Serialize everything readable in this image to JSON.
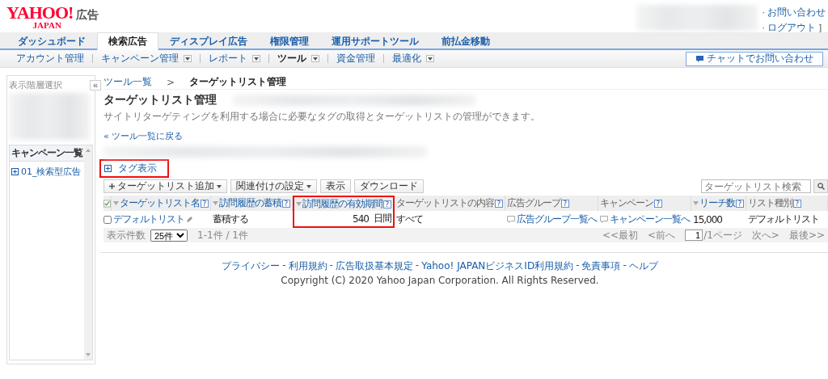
{
  "header": {
    "logo": "YAHOO!",
    "logo_sub": "JAPAN",
    "logo_suffix": "広告",
    "links": [
      "お問い合わせ",
      "ログアウト"
    ],
    "bullet": "·",
    "bracket": "]"
  },
  "tabs": [
    {
      "label": "ダッシュボード",
      "selected": false
    },
    {
      "label": "検索広告",
      "selected": true
    },
    {
      "label": "ディスプレイ広告",
      "selected": false
    },
    {
      "label": "権限管理",
      "selected": false
    },
    {
      "label": "運用サポートツール",
      "selected": false
    },
    {
      "label": "前払金移動",
      "selected": false
    }
  ],
  "subnav": [
    {
      "label": "アカウント管理",
      "dropdown": false,
      "selected": false
    },
    {
      "label": "キャンペーン管理",
      "dropdown": true,
      "selected": false
    },
    {
      "label": "レポート",
      "dropdown": true,
      "selected": false
    },
    {
      "label": "ツール",
      "dropdown": true,
      "selected": true
    },
    {
      "label": "資金管理",
      "dropdown": false,
      "selected": false
    },
    {
      "label": "最適化",
      "dropdown": true,
      "selected": false
    }
  ],
  "chat_button": "チャットでお問い合わせ",
  "sidebar": {
    "title": "表示階層選択",
    "collapse": "«",
    "list_title": "キャンペーン一覧",
    "items": [
      {
        "label": "01_検索型広告"
      }
    ]
  },
  "breadcrumb": {
    "items": [
      "ツール一覧",
      "ターゲットリスト管理"
    ],
    "separator": ">"
  },
  "page_title": "ターゲットリスト管理",
  "description": "サイトリターゲティングを利用する場合に必要なタグの取得とターゲットリストの管理ができます。",
  "back_link": "« ツール一覧に戻る",
  "tag_toggle": {
    "label": "タグ表示",
    "highlighted": true
  },
  "toolbar": [
    {
      "label": "ターゲットリスト追加",
      "plus": true,
      "dropdown": true
    },
    {
      "label": "関連付けの設定",
      "plus": false,
      "dropdown": true
    },
    {
      "label": "表示",
      "plus": false,
      "dropdown": false
    },
    {
      "label": "ダウンロード",
      "plus": false,
      "dropdown": false
    }
  ],
  "search": {
    "placeholder": "ターゲットリスト検索"
  },
  "table": {
    "select_all_checked": true,
    "help": "?",
    "columns": [
      {
        "label": "ターゲットリスト名",
        "sortable": true,
        "highlighted": false
      },
      {
        "label": "訪問履歴の蓄積",
        "sortable": true,
        "highlighted": false
      },
      {
        "label": "訪問履歴の有効期間",
        "sortable": true,
        "highlighted": true
      },
      {
        "label": "ターゲットリストの内容",
        "sortable": false,
        "highlighted": false
      },
      {
        "label": "広告グループ",
        "sortable": false,
        "highlighted": false
      },
      {
        "label": "キャンペーン",
        "sortable": false,
        "highlighted": false
      },
      {
        "label": "リーチ数",
        "sortable": true,
        "highlighted": false
      },
      {
        "label": "リスト種別",
        "sortable": false,
        "highlighted": false
      }
    ],
    "rows": [
      {
        "checked": false,
        "cells": [
          {
            "kind": "edit-link",
            "text": "デフォルトリスト"
          },
          {
            "kind": "text",
            "text": "蓄積する"
          },
          {
            "kind": "days",
            "text": "540",
            "unit": "日間"
          },
          {
            "kind": "text",
            "text": "すべて"
          },
          {
            "kind": "comment-link",
            "text": "広告グループ一覧へ"
          },
          {
            "kind": "comment-link",
            "text": "キャンペーン一覧へ"
          },
          {
            "kind": "text",
            "text": "15,000"
          },
          {
            "kind": "text",
            "text": "デフォルトリスト"
          }
        ]
      }
    ]
  },
  "pager": {
    "per_page_label": "表示件数",
    "per_page": "25件",
    "range": "1-1件 / 1件",
    "first": "<<最初",
    "prev": "<前へ",
    "page": "1",
    "of_pages": "/1ページ",
    "next": "次へ>",
    "last": "最後>>"
  },
  "footer": {
    "links": [
      "プライバシー",
      "利用規約",
      "広告取扱基本規定",
      "Yahoo! JAPANビジネスID利用規約",
      "免責事項",
      "ヘルプ"
    ],
    "separator": "-",
    "copyright": "Copyright (C) 2020 Yahoo Japan Corporation. All Rights Reserved."
  }
}
